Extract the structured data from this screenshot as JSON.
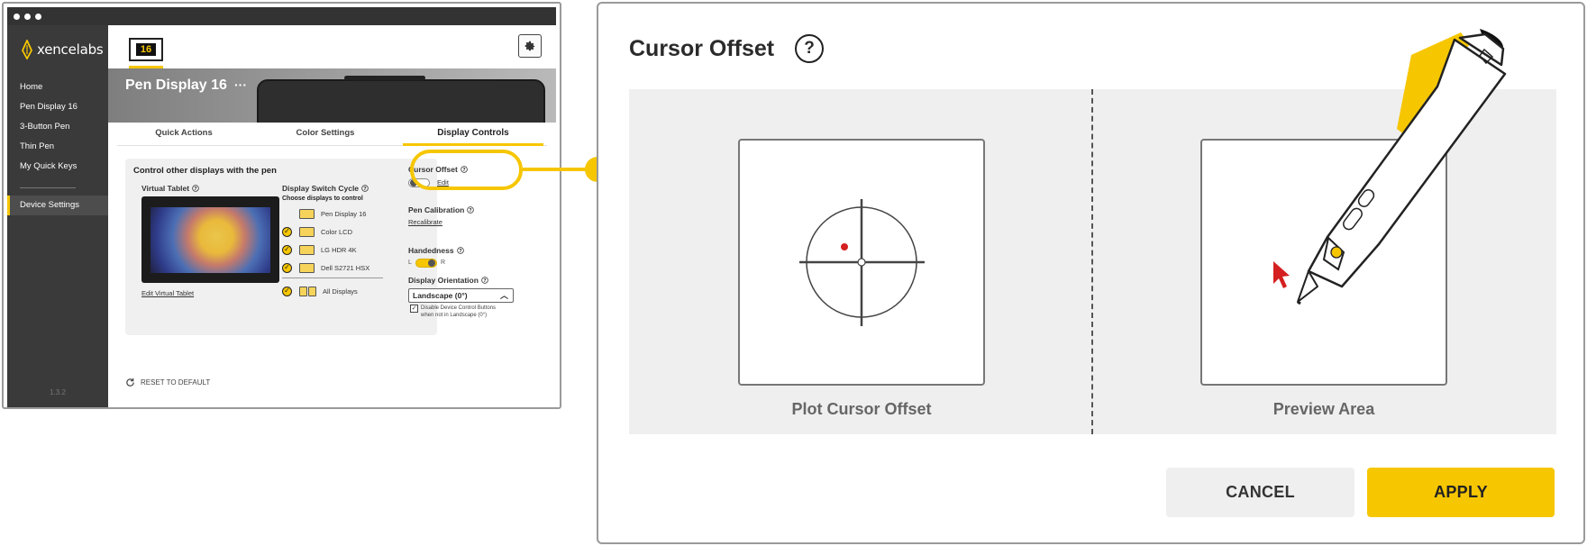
{
  "app": {
    "logo_text": "xencelabs",
    "version": "1.3.2",
    "device_badge": "16",
    "nav": [
      {
        "label": "Home"
      },
      {
        "label": "Pen Display 16"
      },
      {
        "label": "3-Button Pen"
      },
      {
        "label": "Thin Pen"
      },
      {
        "label": "My Quick Keys"
      }
    ],
    "nav_active": "Device Settings",
    "banner_title": "Pen Display 16",
    "banner_more": "···",
    "tabs": [
      {
        "label": "Quick Actions"
      },
      {
        "label": "Color Settings"
      },
      {
        "label": "Display Controls"
      }
    ],
    "card": {
      "title": "Control other displays with the pen",
      "virtual_tablet_label": "Virtual Tablet",
      "edit_virtual_tablet": "Edit Virtual Tablet",
      "display_switch_cycle": "Display Switch Cycle",
      "choose_displays": "Choose displays to control",
      "displays": [
        {
          "name": "Pen Display 16",
          "checked": false
        },
        {
          "name": "Color LCD",
          "checked": true
        },
        {
          "name": "LG HDR 4K",
          "checked": true
        },
        {
          "name": "Dell S2721 HSX",
          "checked": true
        }
      ],
      "all_displays": "All Displays"
    },
    "side": {
      "cursor_offset": "Cursor Offset",
      "edit": "Edit",
      "pen_calibration": "Pen Calibration",
      "recalibrate": "Recalibrate",
      "handedness": "Handedness",
      "hand_left": "L",
      "hand_right": "R",
      "display_orientation": "Display Orientation",
      "orientation_value": "Landscape (0°)",
      "disable_text_1": "Disable Device Control Buttons",
      "disable_text_2": "when not in Landscape (0°)"
    },
    "reset_label": "RESET TO DEFAULT"
  },
  "dialog": {
    "title": "Cursor Offset",
    "help": "?",
    "plot_label": "Plot Cursor Offset",
    "preview_label": "Preview Area",
    "cancel": "CANCEL",
    "apply": "APPLY"
  },
  "colors": {
    "accent": "#f6c600",
    "sidebar": "#3a3a3a",
    "dialog_panel": "#efefef",
    "cursor_red": "#d42020"
  }
}
